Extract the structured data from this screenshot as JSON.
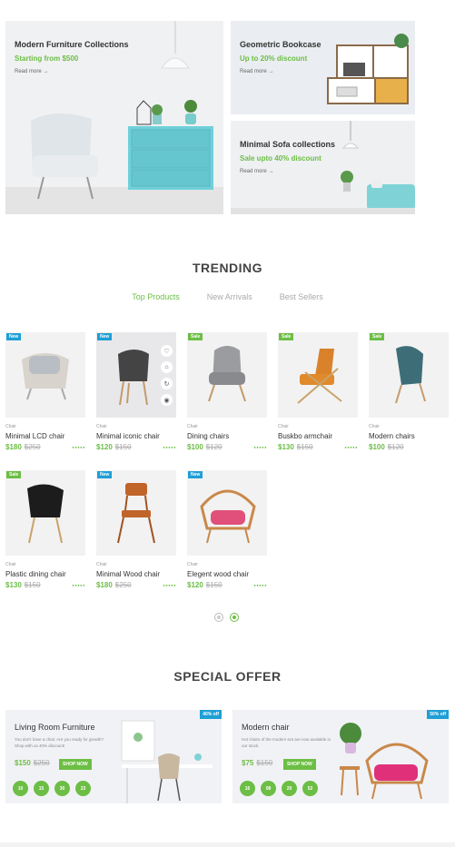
{
  "banners": {
    "main": {
      "title": "Modern Furniture Collections",
      "subtitle": "Starting from $500",
      "link": "Read more →"
    },
    "bookcase": {
      "title": "Geometric Bookcase",
      "subtitle": "Up to 20% discount",
      "link": "Read more →"
    },
    "sofa": {
      "title": "Minimal Sofa collections",
      "subtitle": "Sale upto 40% discount",
      "link": "Read more →"
    }
  },
  "trending": {
    "title": "TRENDING",
    "tabs": [
      "Top Products",
      "New Arrivals",
      "Best Sellers"
    ],
    "products": [
      {
        "badge": "New",
        "category": "Chair",
        "name": "Minimal LCD chair",
        "price": "$180",
        "old_price": "$250"
      },
      {
        "badge": "New",
        "category": "Chair",
        "name": "Minimal iconic chair",
        "price": "$120",
        "old_price": "$150"
      },
      {
        "badge": "Sale",
        "category": "Chair",
        "name": "Dining chairs",
        "price": "$100",
        "old_price": "$120"
      },
      {
        "badge": "Sale",
        "category": "Chair",
        "name": "Buskbo armchair",
        "price": "$130",
        "old_price": "$150"
      },
      {
        "badge": "Sale",
        "category": "Chair",
        "name": "Modern chairs",
        "price": "$100",
        "old_price": "$120"
      },
      {
        "badge": "Sale",
        "category": "Chair",
        "name": "Plastic dining chair",
        "price": "$130",
        "old_price": "$150"
      },
      {
        "badge": "New",
        "category": "Chair",
        "name": "Minimal Wood chair",
        "price": "$180",
        "old_price": "$250"
      },
      {
        "badge": "New",
        "category": "Chair",
        "name": "Elegent wood chair",
        "price": "$120",
        "old_price": "$150"
      }
    ]
  },
  "special_offer": {
    "title": "SPECIAL OFFER",
    "offers": [
      {
        "badge": "40% off",
        "title": "Living Room Furniture",
        "desc": "You don't have a chair. Are you ready for growth? Shop with us 40% discount!",
        "price": "$150",
        "old_price": "$250",
        "button": "SHOP NOW",
        "timer": [
          "10",
          "15",
          "30",
          "23"
        ]
      },
      {
        "badge": "50% off",
        "title": "Modern chair",
        "desc": "Hot chairs of the modern era are now available in our stock.",
        "price": "$75",
        "old_price": "$150",
        "button": "SHOP NOW",
        "timer": [
          "16",
          "08",
          "20",
          "52"
        ]
      }
    ]
  },
  "colors": {
    "accent": "#6cbe45",
    "new_badge": "#1e9fd6",
    "sofa_teal": "#7fd3d6"
  }
}
